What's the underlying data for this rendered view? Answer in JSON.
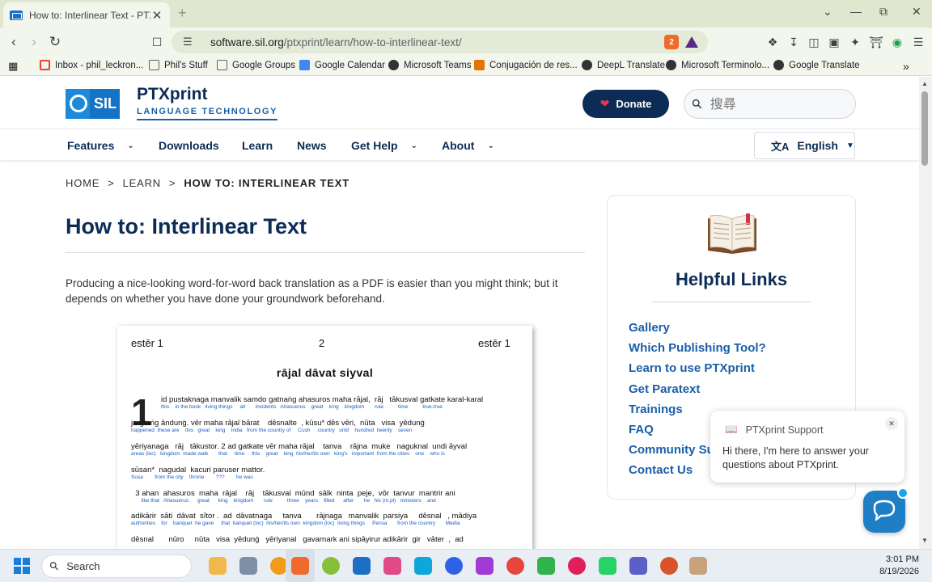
{
  "browser": {
    "tab_title": "How to: Interlinear Text - PTXprint",
    "tab_close": "✕",
    "new_tab": "+",
    "url_host": "software.sil.org",
    "url_path": "/ptxprint/learn/how-to-interlinear-text/",
    "brave_badge": "2",
    "bookmarks": [
      {
        "label": "Inbox - phil_leckron...",
        "icon": "gmail-icon",
        "color": "#ea4335"
      },
      {
        "label": "Phil's Stuff",
        "icon": "folder-icon",
        "color": "#5f6368"
      },
      {
        "label": "Google Groups",
        "icon": "folder-icon",
        "color": "#5f6368"
      },
      {
        "label": "Google Calendar",
        "icon": "calendar-icon",
        "color": "#4285f4"
      },
      {
        "label": "Microsoft Teams",
        "icon": "globe-icon",
        "color": "#333333"
      },
      {
        "label": "Conjugación de res...",
        "icon": "wr-icon",
        "color": "#e37400"
      },
      {
        "label": "DeepL Translate",
        "icon": "globe-icon",
        "color": "#333333"
      },
      {
        "label": "Microsoft Terminolo...",
        "icon": "globe-icon",
        "color": "#333333"
      },
      {
        "label": "Google Translate",
        "icon": "globe-icon",
        "color": "#333333"
      }
    ],
    "more_bookmarks": "»"
  },
  "site": {
    "logo_text": "SIL",
    "brand_name": "PTXprint",
    "brand_sub": "LANGUAGE TECHNOLOGY",
    "donate_label": "Donate",
    "search_placeholder": "搜尋",
    "nav": [
      "Features",
      "Downloads",
      "Learn",
      "News",
      "Get Help",
      "About"
    ],
    "language": "English",
    "breadcrumb": [
      "HOME",
      "LEARN",
      "HOW TO: INTERLINEAR TEXT"
    ],
    "breadcrumb_sep": ">",
    "title": "How to: Interlinear Text",
    "intro": "Producing a nice-looking word-for-word back translation as a PDF is easier than you might think; but it depends on whether you have done your groundwork beforehand."
  },
  "figure": {
    "header_left": "estēr 1",
    "header_center": "2",
    "header_right": "estēr 1",
    "heading": "rājal dāvat siyval",
    "chapter_number": "1",
    "lines": [
      {
        "src": "id pustaknaga manvalik samdo gatnaṅg ahasuros maha rājal,  rāj   tākusval gatkate karal-karal",
        "gloss": "this    in the book   living things     all       incidents   Ahasuerus    great    king    kingdom       rule          time          true-true"
      },
      {
        "src": "jargtaṅg āndunġ. vēr maha rājal bārat    dēsnalte  , kūsu* dēs vēri,  nūta   visa  yēdunġ",
        "gloss": "happened  these are    this   great    king    India   from the country of     Cush     country   until    hundred  twenty    seven"
      },
      {
        "src": "yēriyanaga   rāj   tākustor. 2 ad gatkate vēr maha rājal    tanva    rājna  muke   naguknal  undi āyval",
        "gloss": "areas (loc)   kingdom  made walk       that     time     this    great    king  his/her/its own   king's   important  from the cities    one    who is"
      },
      {
        "src": "sūsan*  nagudal  kacuri paruser mattor.",
        "gloss": "Susa        from the city    throne        ???        he was"
      },
      {
        "src": "  3 ahan  ahasuros  maha  rājal    rāj    tākusval  mūnd  sālk  ninta  peje,  vōr  tanvur  mantrir ani",
        "gloss": "       like that   Ahasuerus      great      king    kingdom       rule          three    years    filled      after       he   his (m.pl)   ministers    and"
      },
      {
        "src": "adikārir  sāti  dāvat  sītor .  ad  dāvatnaga     tanva       rājnaga   manvalik  parsiya     dēsnal   , mādiya",
        "gloss": "authorities    for    banquet  he gave     that  banquet (loc)  his/her/its own  kingdom (loc)  living things     Persia       from the country       Media"
      },
      {
        "src": "dēsnal       nūro     nūta   visa  yēdunġ   yēriyanal   gavarnark ani sipāyirur adikārir  gir   vāter  ,  ad",
        "gloss": ""
      }
    ]
  },
  "sidebar": {
    "title": "Helpful Links",
    "links": [
      "Gallery",
      "Which Publishing Tool?",
      "Learn to use PTXprint",
      "Get Paratext",
      "Trainings",
      "FAQ",
      "Community Su",
      "Contact Us"
    ]
  },
  "chat": {
    "title": "PTXprint Support",
    "close": "✕",
    "message": "Hi there, I'm here to answer your questions about PTXprint."
  },
  "taskbar": {
    "search_label": "Search",
    "time": "3:01 PM",
    "date": "8/19/2026"
  },
  "colors": {
    "brand_navy": "#0b2c55",
    "link_blue": "#1a5fa6",
    "heart": "#e8364f",
    "tab_strip": "#dfe8cf"
  }
}
